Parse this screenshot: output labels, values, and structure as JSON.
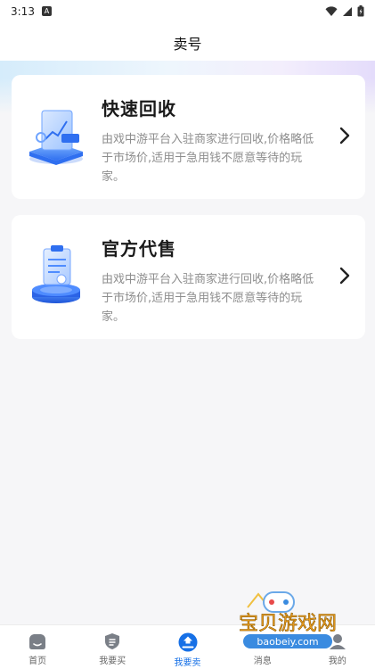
{
  "status_bar": {
    "time": "3:13",
    "notification_glyph": "A"
  },
  "header": {
    "title": "卖号"
  },
  "cards": [
    {
      "title": "快速回收",
      "description": "由戏中游平台入驻商家进行回收,价格略低于市场价,适用于急用钱不愿意等待的玩家。",
      "icon": "chart-document-illustration"
    },
    {
      "title": "官方代售",
      "description": "由戏中游平台入驻商家进行回收,价格略低于市场价,适用于急用钱不愿意等待的玩家。",
      "icon": "clipboard-podium-illustration"
    }
  ],
  "tabs": [
    {
      "label": "首页",
      "icon": "home-icon",
      "active": false
    },
    {
      "label": "我要买",
      "icon": "shield-list-icon",
      "active": false
    },
    {
      "label": "我要卖",
      "icon": "sell-icon",
      "active": true
    },
    {
      "label": "消息",
      "icon": "message-icon",
      "active": false
    },
    {
      "label": "我的",
      "icon": "profile-icon",
      "active": false
    }
  ],
  "watermark": {
    "name": "宝贝游戏网",
    "url": "baobeiy.com"
  },
  "colors": {
    "accent": "#1670e6",
    "title": "#1a1a1a",
    "description": "#8d8d8d",
    "background": "#f6f6f8"
  }
}
